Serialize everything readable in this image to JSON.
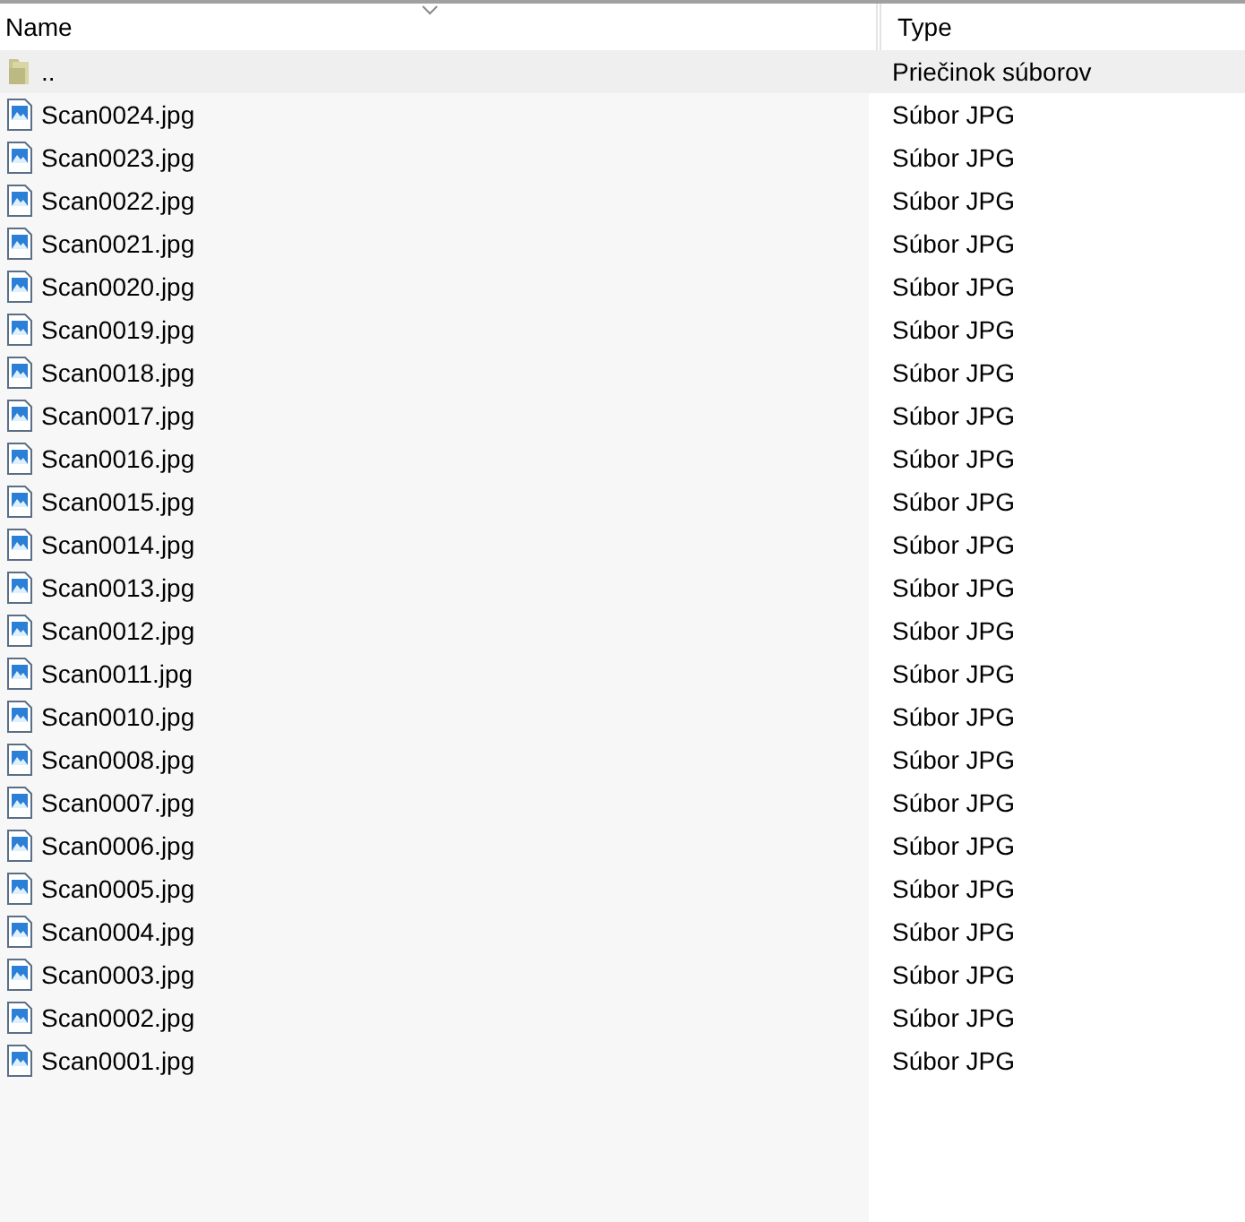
{
  "columns": [
    {
      "label": "Name",
      "sorted": true
    },
    {
      "label": "Type",
      "sorted": false
    }
  ],
  "rows": [
    {
      "kind": "folder",
      "name": "..",
      "type": "Priečinok súborov",
      "selected": true
    },
    {
      "kind": "file",
      "name": "Scan0024.jpg",
      "type": "Súbor JPG",
      "selected": false
    },
    {
      "kind": "file",
      "name": "Scan0023.jpg",
      "type": "Súbor JPG",
      "selected": false
    },
    {
      "kind": "file",
      "name": "Scan0022.jpg",
      "type": "Súbor JPG",
      "selected": false
    },
    {
      "kind": "file",
      "name": "Scan0021.jpg",
      "type": "Súbor JPG",
      "selected": false
    },
    {
      "kind": "file",
      "name": "Scan0020.jpg",
      "type": "Súbor JPG",
      "selected": false
    },
    {
      "kind": "file",
      "name": "Scan0019.jpg",
      "type": "Súbor JPG",
      "selected": false
    },
    {
      "kind": "file",
      "name": "Scan0018.jpg",
      "type": "Súbor JPG",
      "selected": false
    },
    {
      "kind": "file",
      "name": "Scan0017.jpg",
      "type": "Súbor JPG",
      "selected": false
    },
    {
      "kind": "file",
      "name": "Scan0016.jpg",
      "type": "Súbor JPG",
      "selected": false
    },
    {
      "kind": "file",
      "name": "Scan0015.jpg",
      "type": "Súbor JPG",
      "selected": false
    },
    {
      "kind": "file",
      "name": "Scan0014.jpg",
      "type": "Súbor JPG",
      "selected": false
    },
    {
      "kind": "file",
      "name": "Scan0013.jpg",
      "type": "Súbor JPG",
      "selected": false
    },
    {
      "kind": "file",
      "name": "Scan0012.jpg",
      "type": "Súbor JPG",
      "selected": false
    },
    {
      "kind": "file",
      "name": "Scan0011.jpg",
      "type": "Súbor JPG",
      "selected": false
    },
    {
      "kind": "file",
      "name": "Scan0010.jpg",
      "type": "Súbor JPG",
      "selected": false
    },
    {
      "kind": "file",
      "name": "Scan0008.jpg",
      "type": "Súbor JPG",
      "selected": false
    },
    {
      "kind": "file",
      "name": "Scan0007.jpg",
      "type": "Súbor JPG",
      "selected": false
    },
    {
      "kind": "file",
      "name": "Scan0006.jpg",
      "type": "Súbor JPG",
      "selected": false
    },
    {
      "kind": "file",
      "name": "Scan0005.jpg",
      "type": "Súbor JPG",
      "selected": false
    },
    {
      "kind": "file",
      "name": "Scan0004.jpg",
      "type": "Súbor JPG",
      "selected": false
    },
    {
      "kind": "file",
      "name": "Scan0003.jpg",
      "type": "Súbor JPG",
      "selected": false
    },
    {
      "kind": "file",
      "name": "Scan0002.jpg",
      "type": "Súbor JPG",
      "selected": false
    },
    {
      "kind": "file",
      "name": "Scan0001.jpg",
      "type": "Súbor JPG",
      "selected": false
    }
  ]
}
